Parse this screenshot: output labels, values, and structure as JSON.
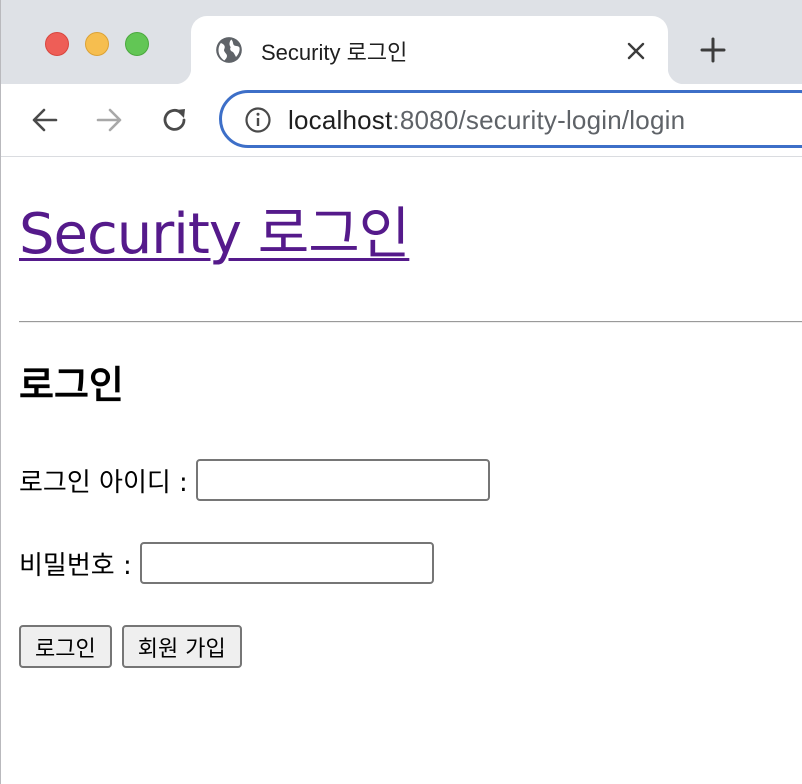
{
  "browser": {
    "tab": {
      "title": "Security 로그인",
      "favicon": "globe-icon"
    },
    "address_bar": {
      "host": "localhost",
      "path": ":8080/security-login/login"
    },
    "icons": {
      "back": "arrow-left-icon",
      "forward": "arrow-right-icon",
      "reload": "reload-icon",
      "info": "info-icon",
      "close": "close-icon",
      "new_tab": "plus-icon"
    },
    "colors": {
      "tabstrip": "#dee1e6",
      "omnibox_border": "#3d6fc8"
    }
  },
  "page": {
    "site_title": "Security 로그인",
    "section_title": "로그인",
    "login_id_label": "로그인 아이디 :",
    "password_label": "비밀번호 :",
    "login_id_value": "",
    "password_value": "",
    "login_button": "로그인",
    "signup_button": "회원 가입",
    "colors": {
      "visited_link": "#551a8b"
    }
  }
}
